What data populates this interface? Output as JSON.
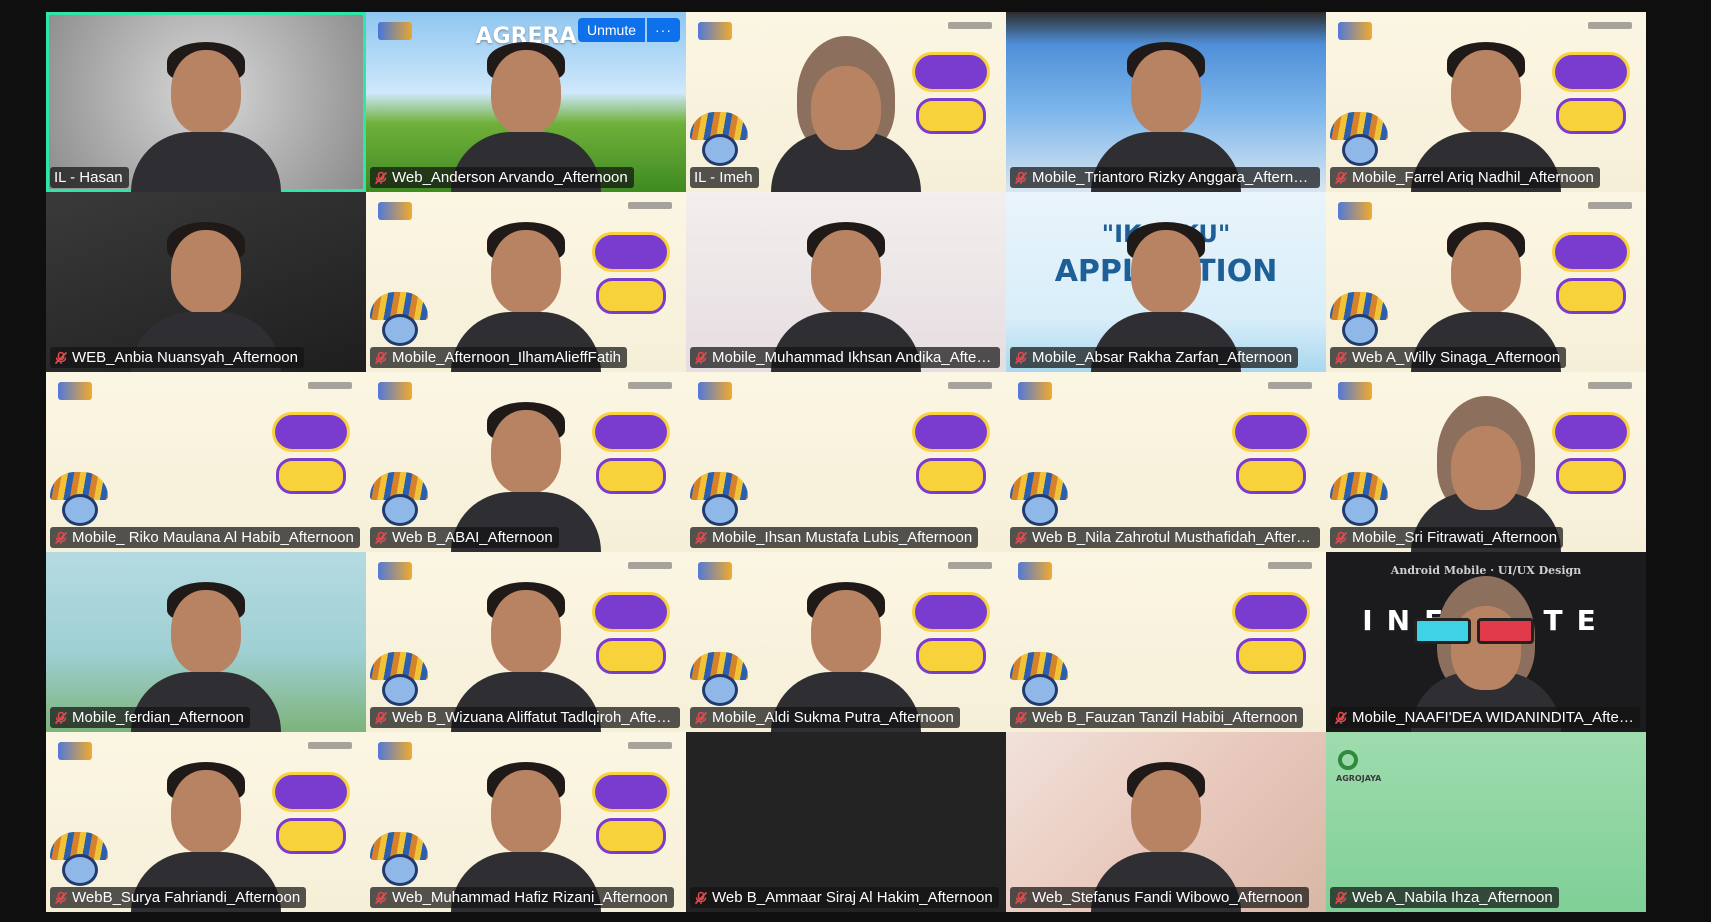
{
  "meeting": {
    "unmute_label": "Unmute",
    "more_label": "···",
    "participants": [
      {
        "name": "IL - Hasan",
        "muted": false,
        "active_speaker": true,
        "bg": "gray"
      },
      {
        "name": "Web_Anderson Arvando_Afternoon",
        "muted": true,
        "bg": "field",
        "title": "AGRERA",
        "has_unmute": true
      },
      {
        "name": "IL - Imeh",
        "muted": false,
        "bg": "cream",
        "hijab": true
      },
      {
        "name": "Mobile_Triantoro Rizky Anggara_Afternoon",
        "muted": true,
        "bg": "room"
      },
      {
        "name": "Mobile_Farrel Ariq Nadhil_Afternoon",
        "muted": true,
        "bg": "cream"
      },
      {
        "name": "WEB_Anbia Nuansyah_Afternoon",
        "muted": true,
        "bg": "dark"
      },
      {
        "name": "Mobile_Afternoon_IlhamAlieffFatih",
        "muted": true,
        "bg": "cream"
      },
      {
        "name": "Mobile_Muhammad Ikhsan Andika_Afternoon",
        "muted": true,
        "bg": "anime"
      },
      {
        "name": "Mobile_Absar Rakha Zarfan_Afternoon",
        "muted": true,
        "bg": "ikan",
        "title": "\"IKANKU\"",
        "title2": "APPLICATION"
      },
      {
        "name": "Web A_Willy Sinaga_Afternoon",
        "muted": true,
        "bg": "cream"
      },
      {
        "name": "Mobile_ Riko Maulana Al Habib_Afternoon",
        "muted": true,
        "bg": "cream",
        "no_person": true
      },
      {
        "name": "Web B_ABAI_Afternoon",
        "muted": true,
        "bg": "cream"
      },
      {
        "name": "Mobile_Ihsan Mustafa Lubis_Afternoon",
        "muted": true,
        "bg": "cream",
        "no_person": true
      },
      {
        "name": "Web B_Nila Zahrotul Musthafidah_Afternoon",
        "muted": true,
        "bg": "cream",
        "no_person": true
      },
      {
        "name": "Mobile_Sri Fitrawati_Afternoon",
        "muted": true,
        "bg": "cream",
        "hijab": true
      },
      {
        "name": "Mobile_ferdian_Afternoon",
        "muted": true,
        "bg": "sponge"
      },
      {
        "name": "Web B_Wizuana Aliffatut Tadlqiroh_Afternoon",
        "muted": true,
        "bg": "cream"
      },
      {
        "name": "Mobile_Aldi Sukma Putra_Afternoon",
        "muted": true,
        "bg": "cream"
      },
      {
        "name": "Web B_Fauzan Tanzil Habibi_Afternoon",
        "muted": true,
        "bg": "cream",
        "no_person": true
      },
      {
        "name": "Mobile_NAAFI'DEA WIDANINDITA_Afternoon",
        "muted": true,
        "bg": "black",
        "title": "INFINITE",
        "title_top": "Android Mobile · UI/UX Design",
        "hijab": true
      },
      {
        "name": "WebB_Surya Fahriandi_Afternoon",
        "muted": true,
        "bg": "cream"
      },
      {
        "name": "Web_Muhammad Hafiz Rizani_Afternoon",
        "muted": true,
        "bg": "cream"
      },
      {
        "name": "Web B_Ammaar Siraj Al Hakim_Afternoon",
        "muted": true,
        "bg": "empty",
        "no_person": true
      },
      {
        "name": "Web_Stefanus Fandi Wibowo_Afternoon",
        "muted": true,
        "bg": "kpop"
      },
      {
        "name": "Web A_Nabila Ihza_Afternoon",
        "muted": true,
        "bg": "green",
        "title": "AGROJAYA",
        "no_person": true
      }
    ]
  },
  "colors": {
    "active_border": "#2ee6a6",
    "unmute_blue": "#0e71eb",
    "muted_red": "#e5484d"
  }
}
